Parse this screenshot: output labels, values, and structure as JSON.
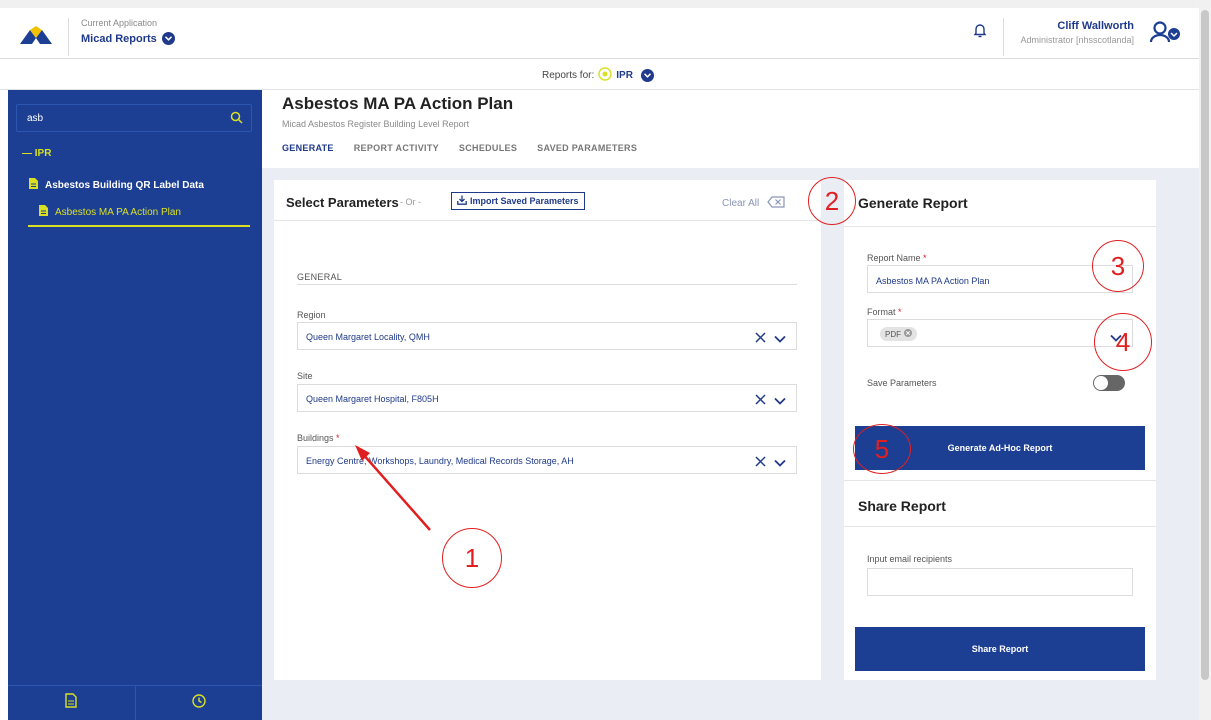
{
  "topbar": {
    "current_app_caption": "Current Application",
    "app_name": "Micad Reports",
    "user_name": "Cliff Wallworth",
    "user_role": "Administrator [nhsscotlanda]"
  },
  "reports_bar": {
    "label": "Reports for:",
    "value": "IPR"
  },
  "sidebar": {
    "search_value": "asb",
    "group": "— IPR",
    "items": [
      {
        "label": "Asbestos Building QR Label Data"
      },
      {
        "label": "Asbestos MA PA Action Plan"
      }
    ]
  },
  "header": {
    "title": "Asbestos MA PA Action Plan",
    "subtitle": "Micad Asbestos Register Building Level Report",
    "tabs": [
      "GENERATE",
      "REPORT ACTIVITY",
      "SCHEDULES",
      "SAVED PARAMETERS"
    ]
  },
  "params": {
    "title": "Select Parameters",
    "or": "- Or -",
    "import_label": "Import Saved Parameters",
    "clear_all": "Clear All",
    "section": "GENERAL",
    "fields": [
      {
        "label": "Region",
        "value": "Queen Margaret Locality, QMH"
      },
      {
        "label": "Site",
        "value": "Queen Margaret Hospital, F805H"
      },
      {
        "label": "Buildings",
        "value": "Energy Centre, Workshops, Laundry, Medical Records Storage, AH"
      }
    ]
  },
  "generate": {
    "title": "Generate Report",
    "report_name_label": "Report Name",
    "report_name_value": "Asbestos MA PA Action Plan",
    "format_label": "Format",
    "format_value": "PDF",
    "save_params_label": "Save Parameters",
    "save_params_on": false,
    "button": "Generate Ad-Hoc Report"
  },
  "share": {
    "title": "Share Report",
    "email_label": "Input email recipients",
    "email_value": "",
    "button": "Share Report"
  },
  "annotations": [
    "1",
    "2",
    "3",
    "4",
    "5"
  ],
  "colors": {
    "primary": "#1c3f94",
    "accent": "#d9e021",
    "annotation": "#e02020"
  }
}
